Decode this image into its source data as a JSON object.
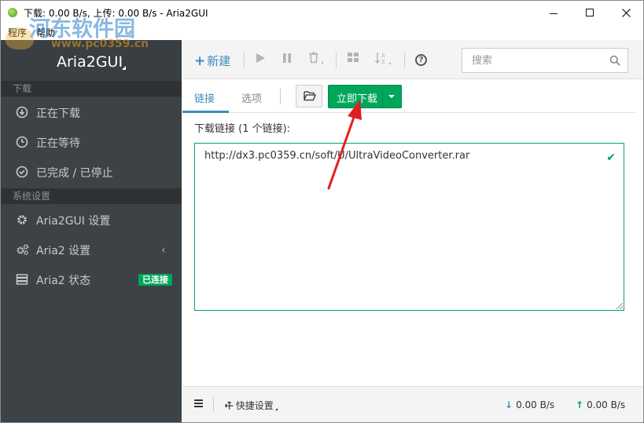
{
  "window": {
    "title": "下载: 0.00 B/s, 上传: 0.00 B/s - Aria2GUI"
  },
  "menubar": {
    "items": [
      "程序",
      "帮助"
    ]
  },
  "watermark": {
    "site_name": "河东软件园",
    "site_url": "www.pc0359.cn"
  },
  "sidebar": {
    "brand": "Aria2GUI",
    "sections": [
      {
        "header": "下载",
        "items": [
          {
            "label": "正在下载",
            "icon": "download-circle-icon"
          },
          {
            "label": "正在等待",
            "icon": "clock-icon"
          },
          {
            "label": "已完成 / 已停止",
            "icon": "check-circle-icon"
          }
        ]
      },
      {
        "header": "系统设置",
        "items": [
          {
            "label": "Aria2GUI 设置",
            "icon": "gear-icon"
          },
          {
            "label": "Aria2 设置",
            "icon": "gears-icon"
          },
          {
            "label": "Aria2 状态",
            "icon": "server-icon",
            "badge": "已连接"
          }
        ]
      }
    ]
  },
  "toolbar": {
    "new_label": "新建",
    "search_placeholder": "搜索"
  },
  "tabs": {
    "active": "链接",
    "inactive": "选项",
    "start_button": "立即下载"
  },
  "content": {
    "download_links_label": "下载链接 (1 个链接):",
    "url_value": "http://dx3.pc0359.cn/soft/U/UltraVideoConverter.rar"
  },
  "footer": {
    "quick_settings": "快捷设置",
    "download_speed": "0.00 B/s",
    "upload_speed": "0.00 B/s"
  },
  "colors": {
    "sidebar_bg": "#3d4246",
    "accent_blue": "#3c8dbc",
    "accent_green": "#00a65a",
    "annotation_red": "#e02020"
  }
}
